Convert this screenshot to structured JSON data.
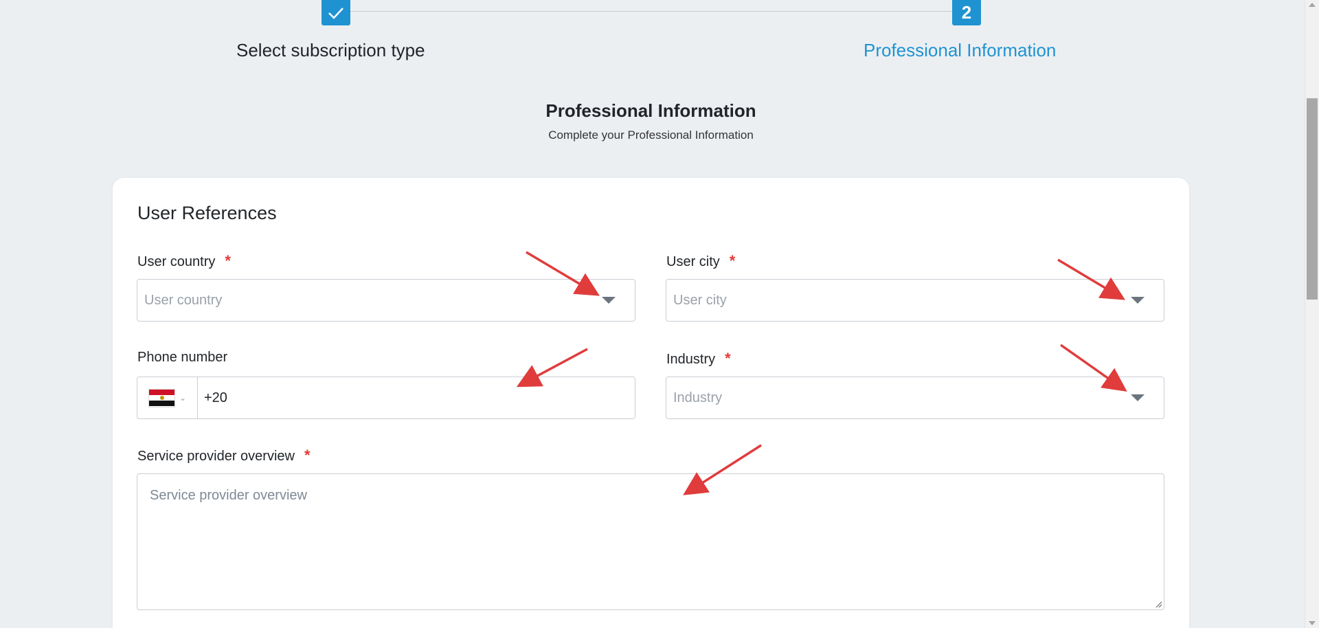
{
  "stepper": {
    "steps": [
      {
        "label": "Select subscription type",
        "marker": "check-icon",
        "status": "completed"
      },
      {
        "label": "Professional Information",
        "marker": "2",
        "status": "active"
      }
    ]
  },
  "heading": {
    "title": "Professional Information",
    "subtitle": "Complete your Professional Information"
  },
  "card": {
    "title": "User References",
    "fields": {
      "country": {
        "label": "User country",
        "required": "*",
        "placeholder": "User country"
      },
      "city": {
        "label": "User city",
        "required": "*",
        "placeholder": "User city"
      },
      "phone": {
        "label": "Phone number",
        "flag": "Egypt",
        "value": "+20"
      },
      "industry": {
        "label": "Industry",
        "required": "*",
        "placeholder": "Industry"
      },
      "overview": {
        "label": "Service provider overview",
        "required": "*",
        "placeholder": "Service provider overview"
      }
    }
  },
  "colors": {
    "accent": "#1f93d1",
    "required": "#e53935",
    "annotation_arrow": "#e03c3c",
    "background": "#eceff2"
  }
}
